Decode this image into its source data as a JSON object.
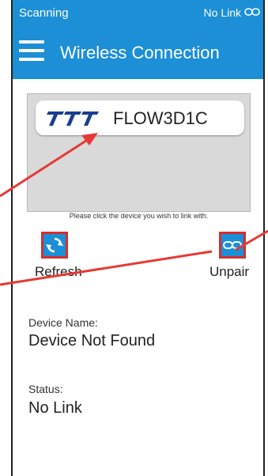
{
  "status_bar": {
    "left_text": "Scanning",
    "right_text": "No Link",
    "link_icon": "chain-link-icon"
  },
  "app_bar": {
    "menu_icon": "hamburger-menu-icon",
    "title": "Wireless Connection",
    "color": "#1c8fd6"
  },
  "device_list": {
    "devices": [
      {
        "name": "FLOW3D1C",
        "logo": "ttt-brand-logo"
      }
    ],
    "hint": "Please click the device you wish to link with."
  },
  "actions": {
    "refresh": {
      "label": "Refresh",
      "icon": "refresh-icon"
    },
    "unpair": {
      "label": "Unpair",
      "icon": "chain-link-icon"
    }
  },
  "info": {
    "device_name_label": "Device Name:",
    "device_name_value": "Device Not Found",
    "status_label": "Status:",
    "status_value": "No Link"
  },
  "colors": {
    "annotation_red": "#e53935",
    "highlight_border": "#d32f2f"
  }
}
